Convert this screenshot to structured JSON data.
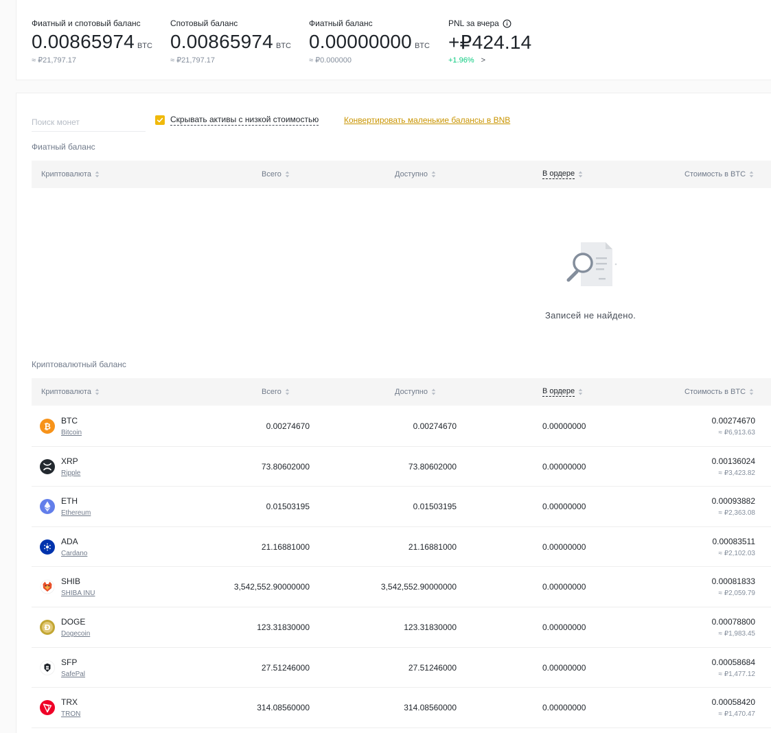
{
  "summary": {
    "total": {
      "label": "Фиатный и спотовый баланс",
      "amount": "0.00865974",
      "unit": "BTC",
      "approx": "≈ ₽21,797.17"
    },
    "spot": {
      "label": "Спотовый баланс",
      "amount": "0.00865974",
      "unit": "BTC",
      "approx": "≈ ₽21,797.17"
    },
    "fiat": {
      "label": "Фиатный баланс",
      "amount": "0.00000000",
      "unit": "BTC",
      "approx": "≈ ₽0.000000"
    },
    "pnl": {
      "label": "PNL за вчера",
      "amount": "+₽424.14",
      "change": "+1.96%",
      "arrow": ">",
      "icon": "info-icon"
    }
  },
  "controls": {
    "search_placeholder": "Поиск монет",
    "hide_small_label": "Скрывать активы с низкой стоимостью",
    "hide_small_checked": true,
    "convert_label": "Конвертировать маленькие балансы в BNB"
  },
  "fiat_section": {
    "title": "Фиатный баланс",
    "empty_text": "Записей не найдено."
  },
  "crypto_section": {
    "title": "Криптовалютный баланс"
  },
  "columns": {
    "coin": "Криптовалюта",
    "total": "Всего",
    "available": "Доступно",
    "in_order": "В ордере",
    "btc_value": "Стоимость в BTC"
  },
  "coins": [
    {
      "symbol": "BTC",
      "name": "Bitcoin",
      "total": "0.00274670",
      "available": "0.00274670",
      "in_order": "0.00000000",
      "btc": "0.00274670",
      "rub": "≈ ₽6,913.63",
      "color": "#f7931a",
      "icon": "bitcoin-icon"
    },
    {
      "symbol": "XRP",
      "name": "Ripple",
      "total": "73.80602000",
      "available": "73.80602000",
      "in_order": "0.00000000",
      "btc": "0.00136024",
      "rub": "≈ ₽3,423.82",
      "color": "#23292f",
      "icon": "ripple-icon"
    },
    {
      "symbol": "ETH",
      "name": "Ethereum",
      "total": "0.01503195",
      "available": "0.01503195",
      "in_order": "0.00000000",
      "btc": "0.00093882",
      "rub": "≈ ₽2,363.08",
      "color": "#627eea",
      "icon": "ethereum-icon"
    },
    {
      "symbol": "ADA",
      "name": "Cardano",
      "total": "21.16881000",
      "available": "21.16881000",
      "in_order": "0.00000000",
      "btc": "0.00083511",
      "rub": "≈ ₽2,102.03",
      "color": "#0033ad",
      "icon": "cardano-icon"
    },
    {
      "symbol": "SHIB",
      "name": "SHIBA INU",
      "total": "3,542,552.90000000",
      "available": "3,542,552.90000000",
      "in_order": "0.00000000",
      "btc": "0.00081833",
      "rub": "≈ ₽2,059.79",
      "color": "#e8502a",
      "icon": "shiba-icon"
    },
    {
      "symbol": "DOGE",
      "name": "Dogecoin",
      "total": "123.31830000",
      "available": "123.31830000",
      "in_order": "0.00000000",
      "btc": "0.00078800",
      "rub": "≈ ₽1,983.45",
      "color": "#c2a633",
      "icon": "dogecoin-icon"
    },
    {
      "symbol": "SFP",
      "name": "SafePal",
      "total": "27.51246000",
      "available": "27.51246000",
      "in_order": "0.00000000",
      "btc": "0.00058684",
      "rub": "≈ ₽1,477.12",
      "color": "#1e2329",
      "icon": "safepal-icon"
    },
    {
      "symbol": "TRX",
      "name": "TRON",
      "total": "314.08560000",
      "available": "314.08560000",
      "in_order": "0.00000000",
      "btc": "0.00058420",
      "rub": "≈ ₽1,470.47",
      "color": "#ef0027",
      "icon": "tron-icon"
    }
  ]
}
